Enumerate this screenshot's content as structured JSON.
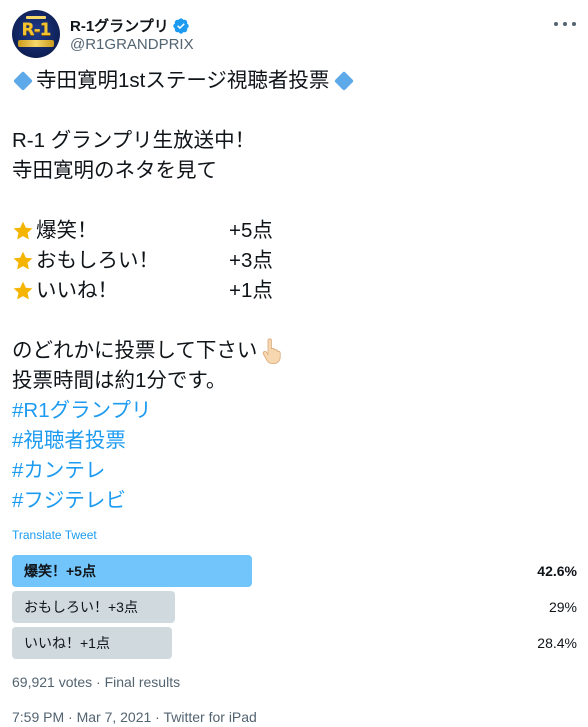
{
  "account": {
    "display_name": "R-1グランプリ",
    "handle": "@R1GRANDPRIX",
    "avatar_logo": "R-1"
  },
  "tweet": {
    "title": "寺田寛明1stステージ視聴者投票",
    "line1": "R-1 グランプリ生放送中！",
    "line2": "寺田寛明のネタを見て",
    "options": [
      {
        "label": "爆笑！",
        "points": "+5点"
      },
      {
        "label": "おもしろい！",
        "points": "+3点"
      },
      {
        "label": "いいね！",
        "points": "+1点"
      }
    ],
    "line3": "のどれかに投票して下さい",
    "line4": "投票時間は約1分です。",
    "hashtags": [
      "#R1グランプリ",
      "#視聴者投票",
      "#カンテレ",
      "#フジテレビ"
    ]
  },
  "translate_label": "Translate Tweet",
  "poll": {
    "choices": [
      {
        "label": "爆笑！+5点",
        "percent": "42.6%",
        "fraction": 0.426,
        "winner": true
      },
      {
        "label": "おもしろい！+3点",
        "percent": "29%",
        "fraction": 0.29,
        "winner": false
      },
      {
        "label": "いいね！+1点",
        "percent": "28.4%",
        "fraction": 0.284,
        "winner": false
      }
    ],
    "meta": "69,921 votes · Final results"
  },
  "timestamp": "7:59 PM · Mar 7, 2021 · Twitter for iPad",
  "colors": {
    "link": "#1d9bf0",
    "poll_winner": "#72c5fb",
    "poll_other": "#cfd9de",
    "diamond": "#5da9e9",
    "star": "#f4b400"
  }
}
